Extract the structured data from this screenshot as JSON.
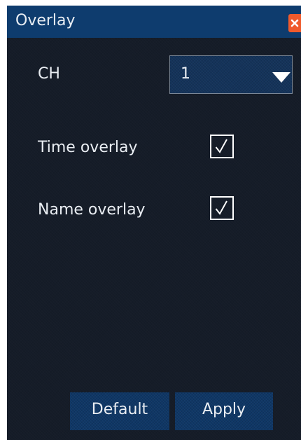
{
  "window": {
    "title": "Overlay",
    "close_icon": "close-icon"
  },
  "channel": {
    "label": "CH",
    "selected": "1"
  },
  "time_overlay": {
    "label": "Time overlay",
    "checked": true
  },
  "name_overlay": {
    "label": "Name overlay",
    "checked": true
  },
  "buttons": {
    "default_label": "Default",
    "apply_label": "Apply"
  },
  "colors": {
    "background": "#151c28",
    "titlebar": "#0e3c6e",
    "button": "#0f3766",
    "close": "#ef5a2c",
    "text": "#e9edf2"
  }
}
